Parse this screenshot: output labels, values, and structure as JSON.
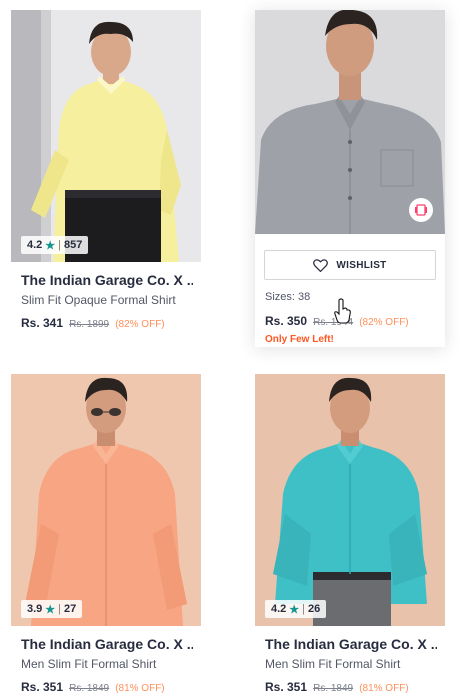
{
  "products": [
    {
      "brand": "The Indian Garage Co. X ...",
      "name": "Slim Fit Opaque Formal Shirt",
      "rating": "4.2",
      "rating_count": "857",
      "price": "Rs. 341",
      "mrp": "Rs. 1899",
      "discount": "(82% OFF)",
      "shirt_color": "#f4ee9a",
      "bg_color": "#e6e6e8"
    },
    {
      "brand": "",
      "name": "",
      "sizes": "Sizes: 38",
      "price": "Rs. 350",
      "mrp": "Rs. 1944",
      "discount": "(82% OFF)",
      "stock_note": "Only Few Left!",
      "wishlist_label": "WISHLIST",
      "shirt_color": "#9ea1a8",
      "bg_color": "#d9d9dc"
    },
    {
      "brand": "The Indian Garage Co. X ...",
      "name": "Men Slim Fit Formal Shirt",
      "rating": "3.9",
      "rating_count": "27",
      "price": "Rs. 351",
      "mrp": "Rs. 1849",
      "discount": "(81% OFF)",
      "shirt_color": "#f7a27f",
      "bg_color": "#efc3a8"
    },
    {
      "brand": "The Indian Garage Co. X ...",
      "name": "Men Slim Fit Formal Shirt",
      "rating": "4.2",
      "rating_count": "26",
      "price": "Rs. 351",
      "mrp": "Rs. 1849",
      "discount": "(81% OFF)",
      "shirt_color": "#3fc0c6",
      "bg_color": "#e7c0a8"
    }
  ],
  "colors": {
    "rating_star": "#14958f",
    "discount": "#ff905a",
    "few_left": "#ff5722",
    "similar_icon": "#ff3f6c"
  },
  "icons": {
    "star": "star-icon",
    "heart": "heart-icon",
    "similar": "view-similar-icon",
    "cursor": "hand-pointer-icon"
  }
}
